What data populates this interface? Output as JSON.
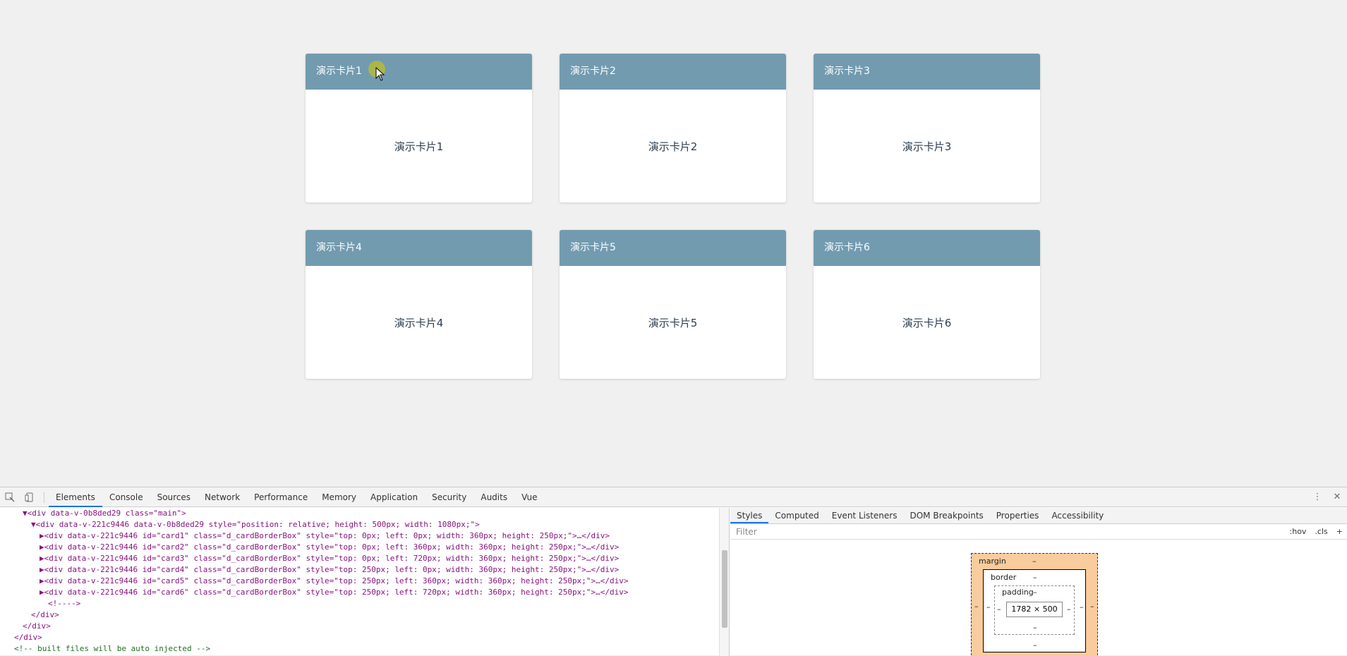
{
  "cards": [
    {
      "title": "演示卡片1",
      "body": "演示卡片1"
    },
    {
      "title": "演示卡片2",
      "body": "演示卡片2"
    },
    {
      "title": "演示卡片3",
      "body": "演示卡片3"
    },
    {
      "title": "演示卡片4",
      "body": "演示卡片4"
    },
    {
      "title": "演示卡片5",
      "body": "演示卡片5"
    },
    {
      "title": "演示卡片6",
      "body": "演示卡片6"
    }
  ],
  "colors": {
    "card_header": "#729bb0",
    "card_text": "#2c3e50",
    "page_bg": "#f0f0f0",
    "accent": "#1a73e8"
  },
  "devtools": {
    "tabs": [
      "Elements",
      "Console",
      "Sources",
      "Network",
      "Performance",
      "Memory",
      "Application",
      "Security",
      "Audits",
      "Vue"
    ],
    "active_tab": "Elements",
    "code_lines": [
      "▼<div data-v-0b8ded29 class=\"main\">",
      "▼<div data-v-221c9446 data-v-0b8ded29 style=\"position: relative; height: 500px; width: 1080px;\">",
      "▶<div data-v-221c9446 id=\"card1\" class=\"d_cardBorderBox\" style=\"top: 0px; left: 0px; width: 360px; height: 250px;\">…</div>",
      "▶<div data-v-221c9446 id=\"card2\" class=\"d_cardBorderBox\" style=\"top: 0px; left: 360px; width: 360px; height: 250px;\">…</div>",
      "▶<div data-v-221c9446 id=\"card3\" class=\"d_cardBorderBox\" style=\"top: 0px; left: 720px; width: 360px; height: 250px;\">…</div>",
      "▶<div data-v-221c9446 id=\"card4\" class=\"d_cardBorderBox\" style=\"top: 250px; left: 0px; width: 360px; height: 250px;\">…</div>",
      "▶<div data-v-221c9446 id=\"card5\" class=\"d_cardBorderBox\" style=\"top: 250px; left: 360px; width: 360px; height: 250px;\">…</div>",
      "▶<div data-v-221c9446 id=\"card6\" class=\"d_cardBorderBox\" style=\"top: 250px; left: 720px; width: 360px; height: 250px;\">…</div>",
      "<!---->",
      "</div>",
      "</div>",
      "</div>",
      "<!-- built files will be auto injected -->"
    ],
    "styles_tabs": [
      "Styles",
      "Computed",
      "Event Listeners",
      "DOM Breakpoints",
      "Properties",
      "Accessibility"
    ],
    "active_styles_tab": "Styles",
    "filter_placeholder": "Filter",
    "hov_label": ":hov",
    "cls_label": ".cls",
    "box_model": {
      "margin_label": "margin",
      "border_label": "border",
      "padding_label": "padding",
      "dash": "–",
      "content_size": "1782 × 500"
    }
  }
}
